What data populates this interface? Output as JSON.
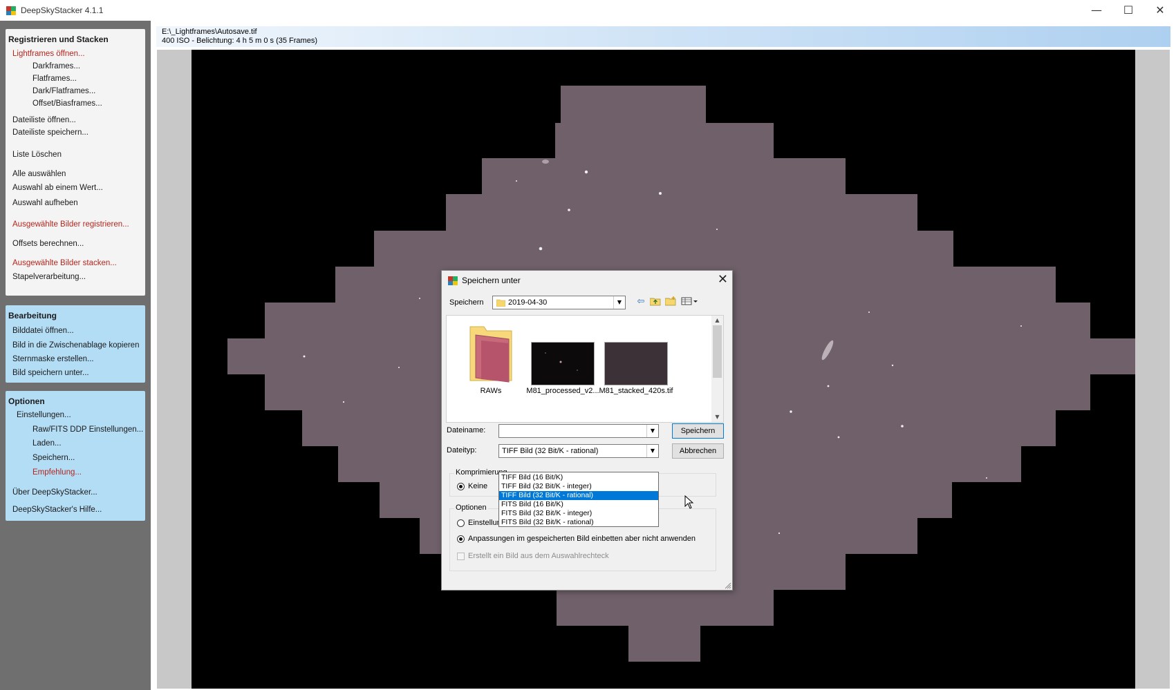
{
  "window": {
    "title": "DeepSkyStacker 4.1.1"
  },
  "sidebar": {
    "register": {
      "heading": "Registrieren und Stacken",
      "items": [
        {
          "label": "Lightframes öffnen...",
          "red": true
        },
        {
          "label": "Darkframes..."
        },
        {
          "label": "Flatframes..."
        },
        {
          "label": "Dark/Flatframes..."
        },
        {
          "label": "Offset/Biasframes..."
        },
        {
          "label": "Dateiliste öffnen..."
        },
        {
          "label": "Dateiliste speichern..."
        },
        {
          "label": "Liste Löschen"
        },
        {
          "label": "Alle auswählen"
        },
        {
          "label": "Auswahl ab einem Wert..."
        },
        {
          "label": "Auswahl aufheben"
        },
        {
          "label": "Ausgewählte Bilder registrieren...",
          "red": true
        },
        {
          "label": "Offsets berechnen..."
        },
        {
          "label": "Ausgewählte Bilder stacken...",
          "red": true
        },
        {
          "label": "Stapelverarbeitung..."
        }
      ]
    },
    "edit": {
      "heading": "Bearbeitung",
      "items": [
        {
          "label": "Bilddatei öffnen..."
        },
        {
          "label": "Bild in die Zwischenablage kopieren"
        },
        {
          "label": "Sternmaske erstellen..."
        },
        {
          "label": "Bild speichern unter..."
        }
      ]
    },
    "options": {
      "heading": "Optionen",
      "items": [
        {
          "label": "Einstellungen..."
        },
        {
          "label": "Raw/FITS DDP Einstellungen..."
        },
        {
          "label": "Laden..."
        },
        {
          "label": "Speichern..."
        },
        {
          "label": "Empfehlung...",
          "red": true
        },
        {
          "label": "Über DeepSkyStacker..."
        },
        {
          "label": "DeepSkyStacker's Hilfe..."
        }
      ]
    }
  },
  "info": {
    "path": "E:\\_Lightframes\\Autosave.tif",
    "details": "400 ISO - Belichtung: 4 h 5 m 0 s (35 Frames)"
  },
  "dialog": {
    "title": "Speichern unter",
    "save_in_label": "Speichern",
    "folder": "2019-04-30",
    "files": [
      {
        "name": "RAWs",
        "kind": "folder"
      },
      {
        "name": "M81_processed_v2...",
        "kind": "image-dark"
      },
      {
        "name": "M81_stacked_420s.tif",
        "kind": "image-flat"
      }
    ],
    "filename_label": "Dateiname:",
    "filename_value": "",
    "filetype_label": "Dateityp:",
    "filetype_value": "TIFF Bild (32 Bit/K - rational)",
    "save_button": "Speichern",
    "cancel_button": "Abbrechen",
    "compression_label": "Komprimierung",
    "compression_none": "Keine",
    "options_label": "Optionen",
    "option_1": "Einstellungen für das gespeicherte Bild übernehmen",
    "option_2": "Anpassungen im gespeicherten Bild einbetten aber nicht anwenden",
    "option_3": "Erstellt ein Bild aus dem Auswahlrechteck",
    "filetype_options": [
      "TIFF Bild (16 Bit/K)",
      "TIFF Bild (32 Bit/K - integer)",
      "TIFF Bild (32 Bit/K - rational)",
      "FITS Bild (16 Bit/K)",
      "FITS Bild (32 Bit/K - integer)",
      "FITS Bild (32 Bit/K - rational)"
    ],
    "filetype_selected_index": 2
  },
  "colors": {
    "accent": "#0078d7",
    "sidebar_bg": "#6f6f6f",
    "panel_blue": "#b3dcf5",
    "red_link": "#b3261e",
    "sky": "#6f6069"
  },
  "icons": {
    "back": "back-arrow-icon",
    "up": "folder-up-icon",
    "new_folder": "new-folder-icon",
    "view": "view-menu-icon"
  }
}
